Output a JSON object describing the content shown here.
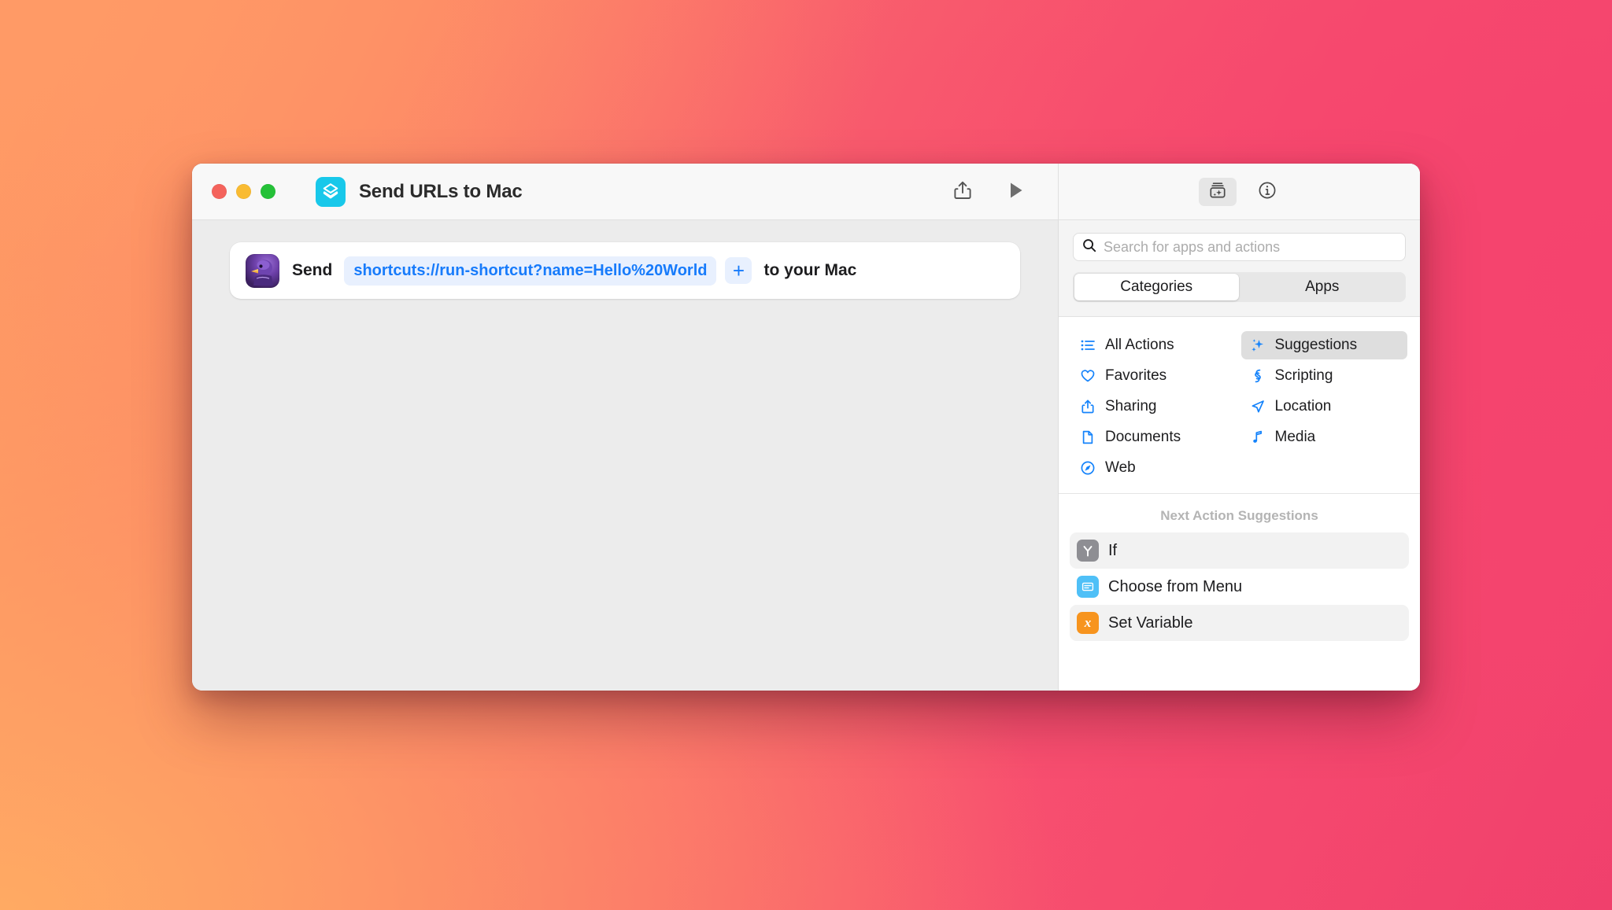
{
  "window": {
    "title": "Send URLs to Mac",
    "app_icon": "shortcuts-layers-icon",
    "traffic_lights": {
      "close": "close-button",
      "minimize": "minimize-button",
      "maximize": "maximize-button"
    },
    "toolbar": {
      "share_label": "share-icon",
      "run_label": "play-icon",
      "library_label": "action-library-icon",
      "info_label": "info-icon"
    }
  },
  "canvas": {
    "action": {
      "avatar": "duck-avatar-icon",
      "prefix": "Send",
      "url_value": "shortcuts://run-shortcut?name=Hello%20World",
      "add_label": "+",
      "suffix": "to your Mac"
    }
  },
  "sidebar": {
    "search": {
      "placeholder": "Search for apps and actions",
      "value": "",
      "icon": "search-icon"
    },
    "segments": [
      {
        "label": "Categories",
        "selected": true
      },
      {
        "label": "Apps",
        "selected": false
      }
    ],
    "categories": [
      {
        "label": "All Actions",
        "icon": "list-bullet-icon",
        "selected": false
      },
      {
        "label": "Suggestions",
        "icon": "sparkles-icon",
        "selected": true
      },
      {
        "label": "Favorites",
        "icon": "heart-icon",
        "selected": false
      },
      {
        "label": "Scripting",
        "icon": "script-icon",
        "selected": false
      },
      {
        "label": "Sharing",
        "icon": "share-icon",
        "selected": false
      },
      {
        "label": "Location",
        "icon": "navigation-icon",
        "selected": false
      },
      {
        "label": "Documents",
        "icon": "document-icon",
        "selected": false
      },
      {
        "label": "Media",
        "icon": "music-note-icon",
        "selected": false
      },
      {
        "label": "Web",
        "icon": "compass-icon",
        "selected": false
      }
    ],
    "next_actions": {
      "header": "Next Action Suggestions",
      "items": [
        {
          "label": "If",
          "icon": "if-branch-icon",
          "icon_color": "#8E8E93",
          "glyph": "Y"
        },
        {
          "label": "Choose from Menu",
          "icon": "menu-card-icon",
          "icon_color": "#4FC0F7",
          "glyph": "▤"
        },
        {
          "label": "Set Variable",
          "icon": "variable-x-icon",
          "icon_color": "#F7941E",
          "glyph": "x"
        }
      ]
    }
  },
  "colors": {
    "accent_blue": "#177BFB",
    "app_icon_cyan": "#18C8EA",
    "canvas_gray": "#ECECEC",
    "selected_gray": "#DEDEDE"
  }
}
